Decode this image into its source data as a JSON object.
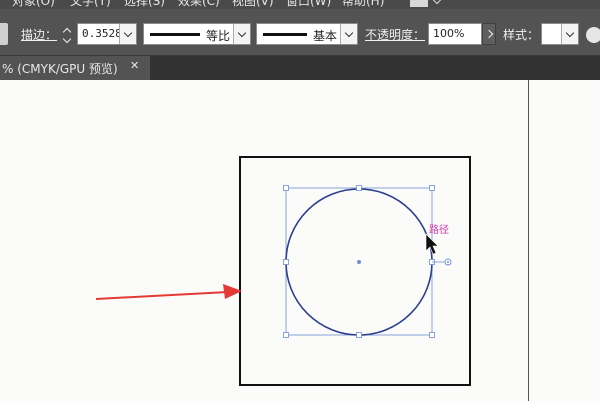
{
  "menubar": {
    "items": [
      "对象(O)",
      "文字(T)",
      "选择(S)",
      "效果(C)",
      "视图(V)",
      "窗口(W)",
      "帮助(H)"
    ]
  },
  "control_bar": {
    "stroke_label": "描边：",
    "stroke_value": "0.3528",
    "profile_label": "等比",
    "brush_label": "基本",
    "opacity_label": "不透明度：",
    "opacity_value": "100%",
    "style_label": "样式："
  },
  "document_tab": {
    "title": "% (CMYK/GPU 预览)",
    "close_glyph": "✕"
  },
  "canvas": {
    "path_hint": "路径",
    "path_color": "#2b3f8f",
    "selection_color": "#6b8ed6",
    "hint_color": "#d23aa8",
    "arrow_color": "#e53935"
  }
}
